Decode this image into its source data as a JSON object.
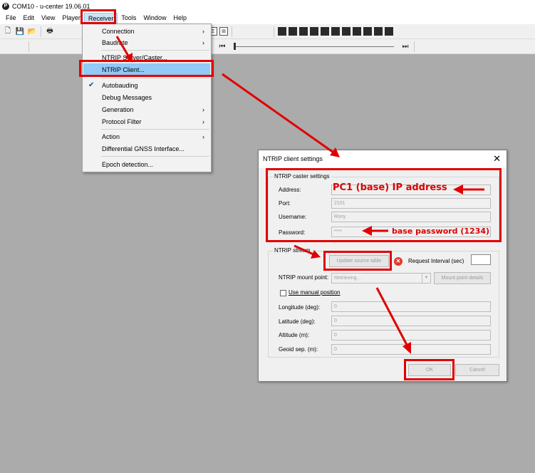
{
  "window": {
    "app_icon_letter": "P",
    "title": "COM10 - u-center 19.06.01"
  },
  "menubar": {
    "items": [
      "File",
      "Edit",
      "View",
      "Player",
      "Receiver",
      "Tools",
      "Window",
      "Help"
    ],
    "active": "Receiver"
  },
  "receiver_menu": {
    "items": [
      {
        "label": "Connection",
        "submenu": true
      },
      {
        "label": "Baudrate",
        "submenu": true
      },
      {
        "label": "NTRIP Server/Caster..."
      },
      {
        "label": "NTRIP Client...",
        "highlighted": true
      },
      {
        "label": "Autobauding",
        "checked": true
      },
      {
        "label": "Debug Messages"
      },
      {
        "label": "Generation",
        "submenu": true
      },
      {
        "label": "Protocol Filter",
        "submenu": true
      },
      {
        "label": "Action",
        "submenu": true
      },
      {
        "label": "Differential GNSS Interface..."
      },
      {
        "label": "Epoch detection..."
      }
    ],
    "arrow_glyph": "›",
    "check_glyph": "✔"
  },
  "dialog": {
    "title": "NTRIP client settings",
    "close_glyph": "✕",
    "caster_group": {
      "label": "NTRIP caster settings",
      "address_label": "Address:",
      "address_value": "",
      "port_label": "Port:",
      "port_value": "2101",
      "username_label": "Username:",
      "username_value": "Rony",
      "password_label": "Password:",
      "password_value": "****"
    },
    "stream_group": {
      "label": "NTRIP stream",
      "update_button": "Update source table",
      "error_glyph": "✕",
      "request_interval_label": "Request Interval (sec)",
      "mount_point_label": "NTRIP mount point:",
      "mount_point_value": "Retrieving...",
      "mount_point_details_button": "Mount point details",
      "manual_position_label": "Use manual position",
      "longitude_label": "Longitude (deg):",
      "longitude_value": "0",
      "latitude_label": "Latitude (deg):",
      "latitude_value": "0",
      "altitude_label": "Altitude (m):",
      "altitude_value": "0",
      "geoid_label": "Geoid sep. (m):",
      "geoid_value": "0"
    },
    "ok_button": "OK",
    "cancel_button": "Cancel"
  },
  "annotations": {
    "address_note": "PC1 (base) IP address",
    "password_note": "base password (1234)",
    "color": "#e00000"
  },
  "toolbar": {
    "new_icon": "🗋",
    "save_icon": "💾",
    "open_icon": "📂",
    "print_icon": "🖶",
    "glyph_a": "Σ",
    "glyph_b": "⊞",
    "play_icon": "⏵",
    "rewind_icon": "⏮",
    "end_icon": "⏭"
  }
}
